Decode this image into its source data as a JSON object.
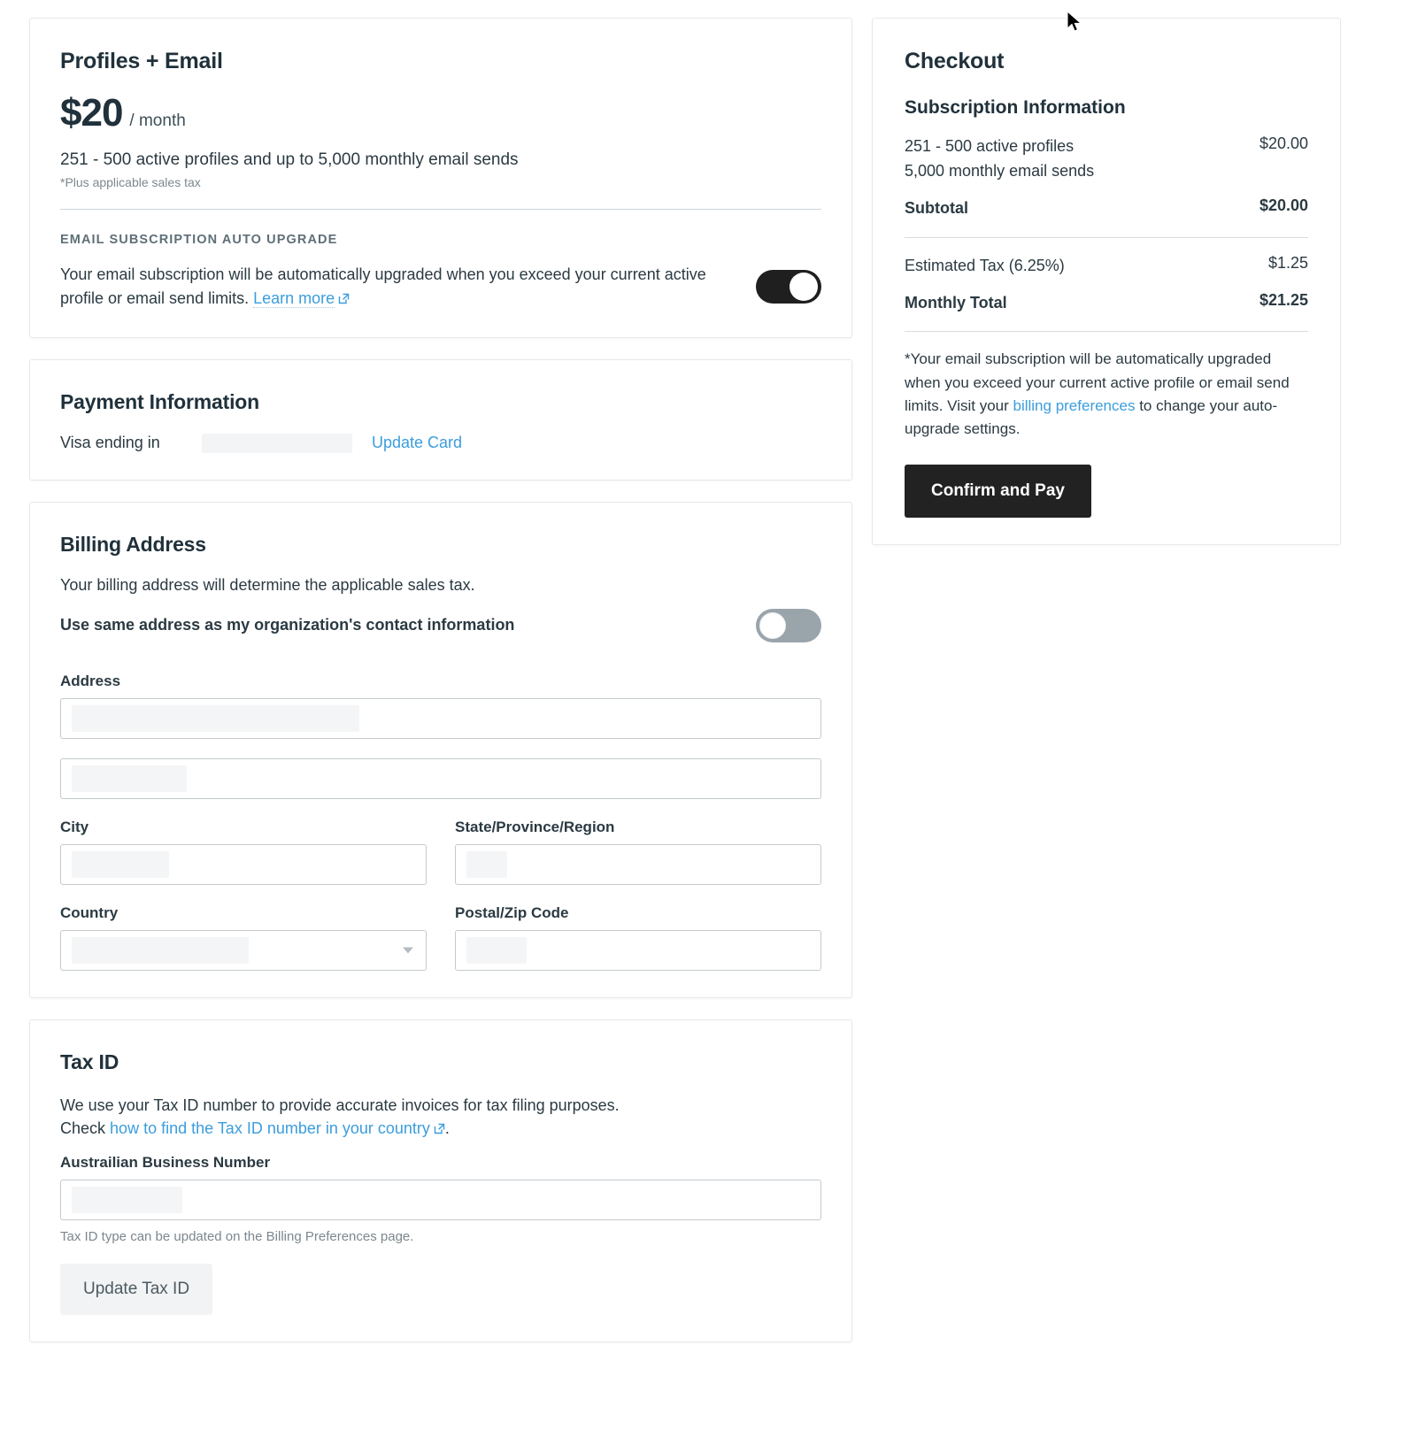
{
  "plan": {
    "title": "Profiles + Email",
    "price_amount": "$20",
    "price_period": "/ month",
    "description": "251 - 500 active profiles and up to 5,000 monthly email sends",
    "tax_note": "*Plus applicable sales tax",
    "auto_upgrade_eyebrow": "EMAIL SUBSCRIPTION AUTO UPGRADE",
    "auto_upgrade_text": "Your email subscription will be automatically upgraded when you exceed your current active profile or email send limits.",
    "learn_more_label": "Learn more",
    "auto_upgrade_toggle_state": "on"
  },
  "payment": {
    "heading": "Payment Information",
    "card_label": "Visa ending in",
    "card_digits": "",
    "update_card_label": "Update Card"
  },
  "billing_address": {
    "heading": "Billing Address",
    "help_text": "Your billing address will determine the applicable sales tax.",
    "same_address_label": "Use same address as my organization's contact information",
    "same_address_toggle_state": "off",
    "address_label": "Address",
    "address_line1_value": "",
    "address_line2_value": "",
    "city_label": "City",
    "city_value": "",
    "state_label": "State/Province/Region",
    "state_value": "",
    "country_label": "Country",
    "country_value": "",
    "postal_label": "Postal/Zip Code",
    "postal_value": ""
  },
  "tax_id": {
    "heading": "Tax ID",
    "description_line1": "We use your Tax ID number to provide accurate invoices for tax filing purposes.",
    "description_check_prefix": "Check",
    "description_link": "how to find the Tax ID number in your country",
    "description_suffix": ".",
    "field_label": "Austrailian Business Number",
    "field_value": "",
    "note": "Tax ID type can be updated on the Billing Preferences page.",
    "update_button_label": "Update Tax ID"
  },
  "checkout": {
    "title": "Checkout",
    "subscription_heading": "Subscription Information",
    "line_items": [
      {
        "desc_line1": "251 - 500 active profiles",
        "desc_line2": "5,000 monthly email sends",
        "amount": "$20.00"
      }
    ],
    "subtotal_label": "Subtotal",
    "subtotal_amount": "$20.00",
    "tax_label": "Estimated Tax (6.25%)",
    "tax_amount": "$1.25",
    "total_label": "Monthly Total",
    "total_amount": "$21.25",
    "disclaimer_part1": "*Your email subscription will be automatically upgraded when you exceed your current active profile or email send limits. Visit your ",
    "disclaimer_link": "billing preferences",
    "disclaimer_part2": " to change your auto-upgrade settings.",
    "confirm_button_label": "Confirm and Pay"
  },
  "colors": {
    "link": "#3b9ddd",
    "primary_button": "#222222",
    "toggle_on": "#1f1f1f",
    "toggle_off": "#9aa4ab",
    "text": "#2b3a42"
  }
}
